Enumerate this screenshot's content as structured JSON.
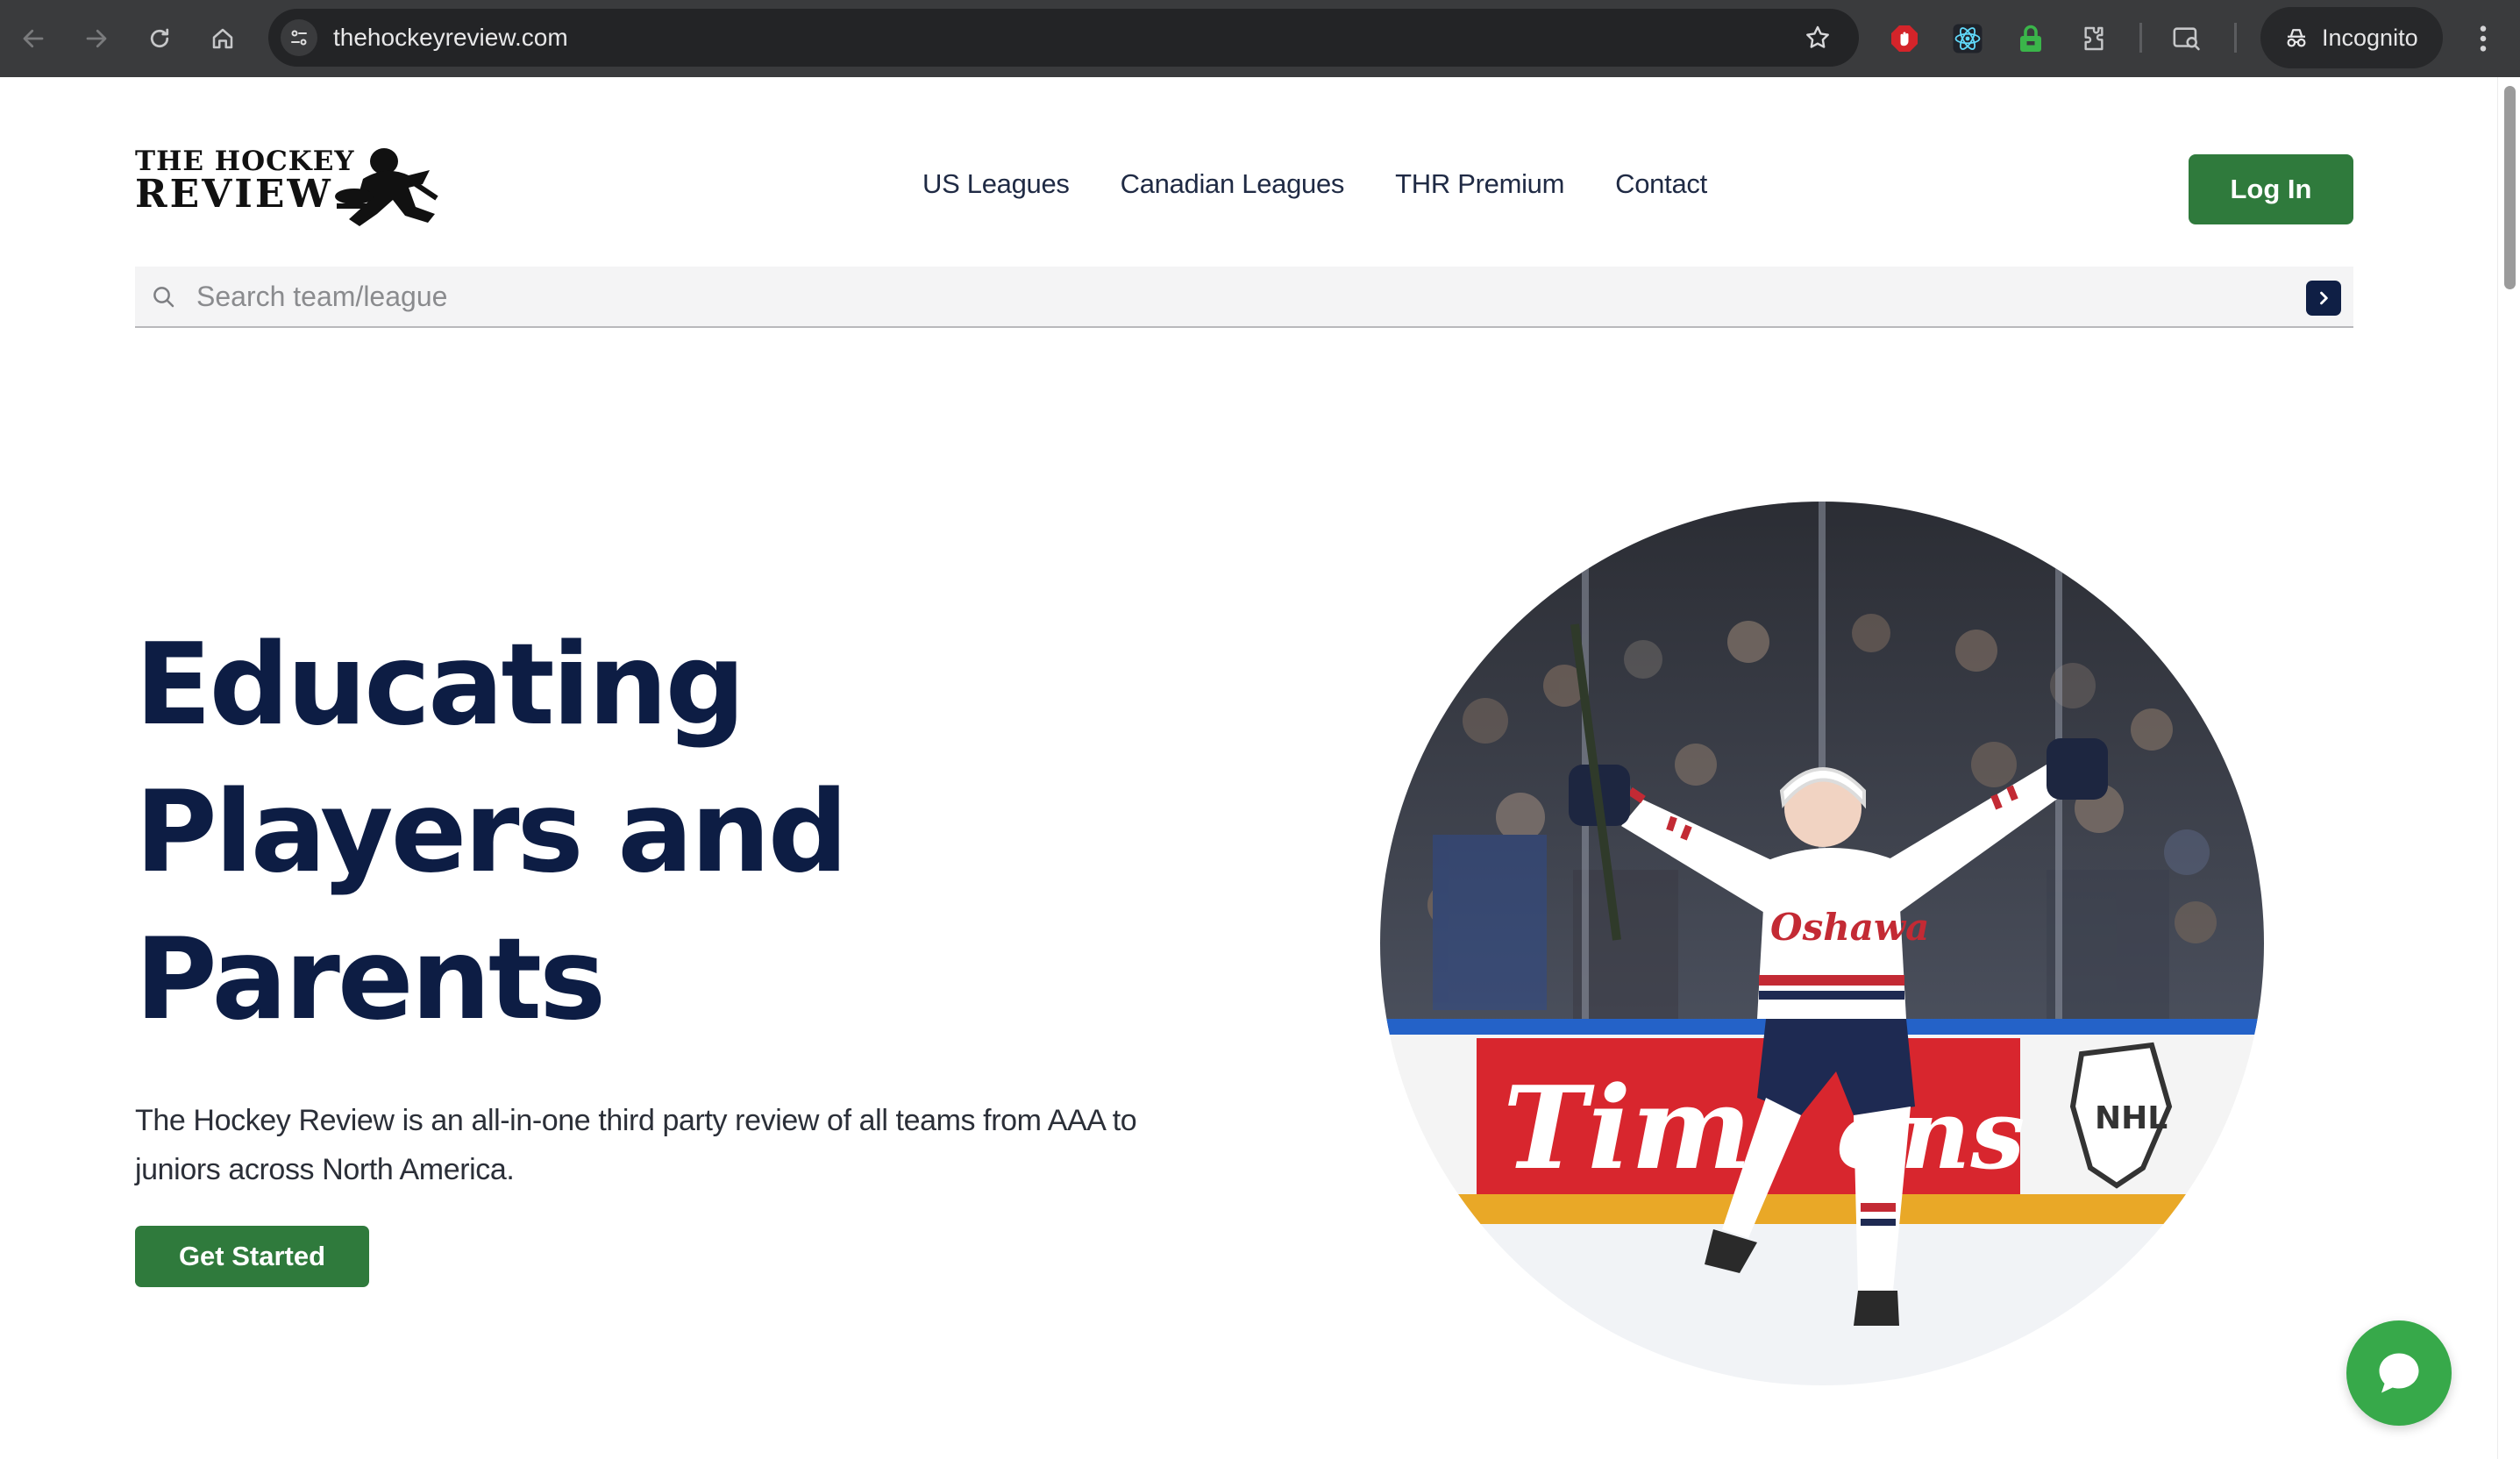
{
  "browser": {
    "url": "thehockeyreview.com",
    "profile_label": "Incognito",
    "icons": [
      "back-arrow-icon",
      "forward-arrow-icon",
      "reload-icon",
      "home-icon",
      "site-settings-icon",
      "bookmark-star-icon",
      "extension-adblock-icon",
      "extension-react-icon",
      "extension-lock-icon",
      "extensions-puzzle-icon",
      "tab-search-icon",
      "incognito-icon",
      "kebab-menu-icon"
    ]
  },
  "site": {
    "logo": {
      "line1": "THE HOCKEY",
      "line2": "REVIEW"
    },
    "nav": [
      {
        "label": "US Leagues"
      },
      {
        "label": "Canadian Leagues"
      },
      {
        "label": "THR Premium"
      },
      {
        "label": "Contact"
      }
    ],
    "login_label": "Log In",
    "search": {
      "placeholder": "Search team/league"
    },
    "hero": {
      "title_lines": [
        "Educating",
        "Players and",
        "Parents"
      ],
      "description": "The Hockey Review is an all-in-one third party review of all teams from AAA to juniors across North America.",
      "cta_label": "Get Started"
    },
    "colors": {
      "brand_green": "#2f7a3c",
      "navy": "#0d1d44",
      "chat_green": "#37a94a"
    }
  }
}
